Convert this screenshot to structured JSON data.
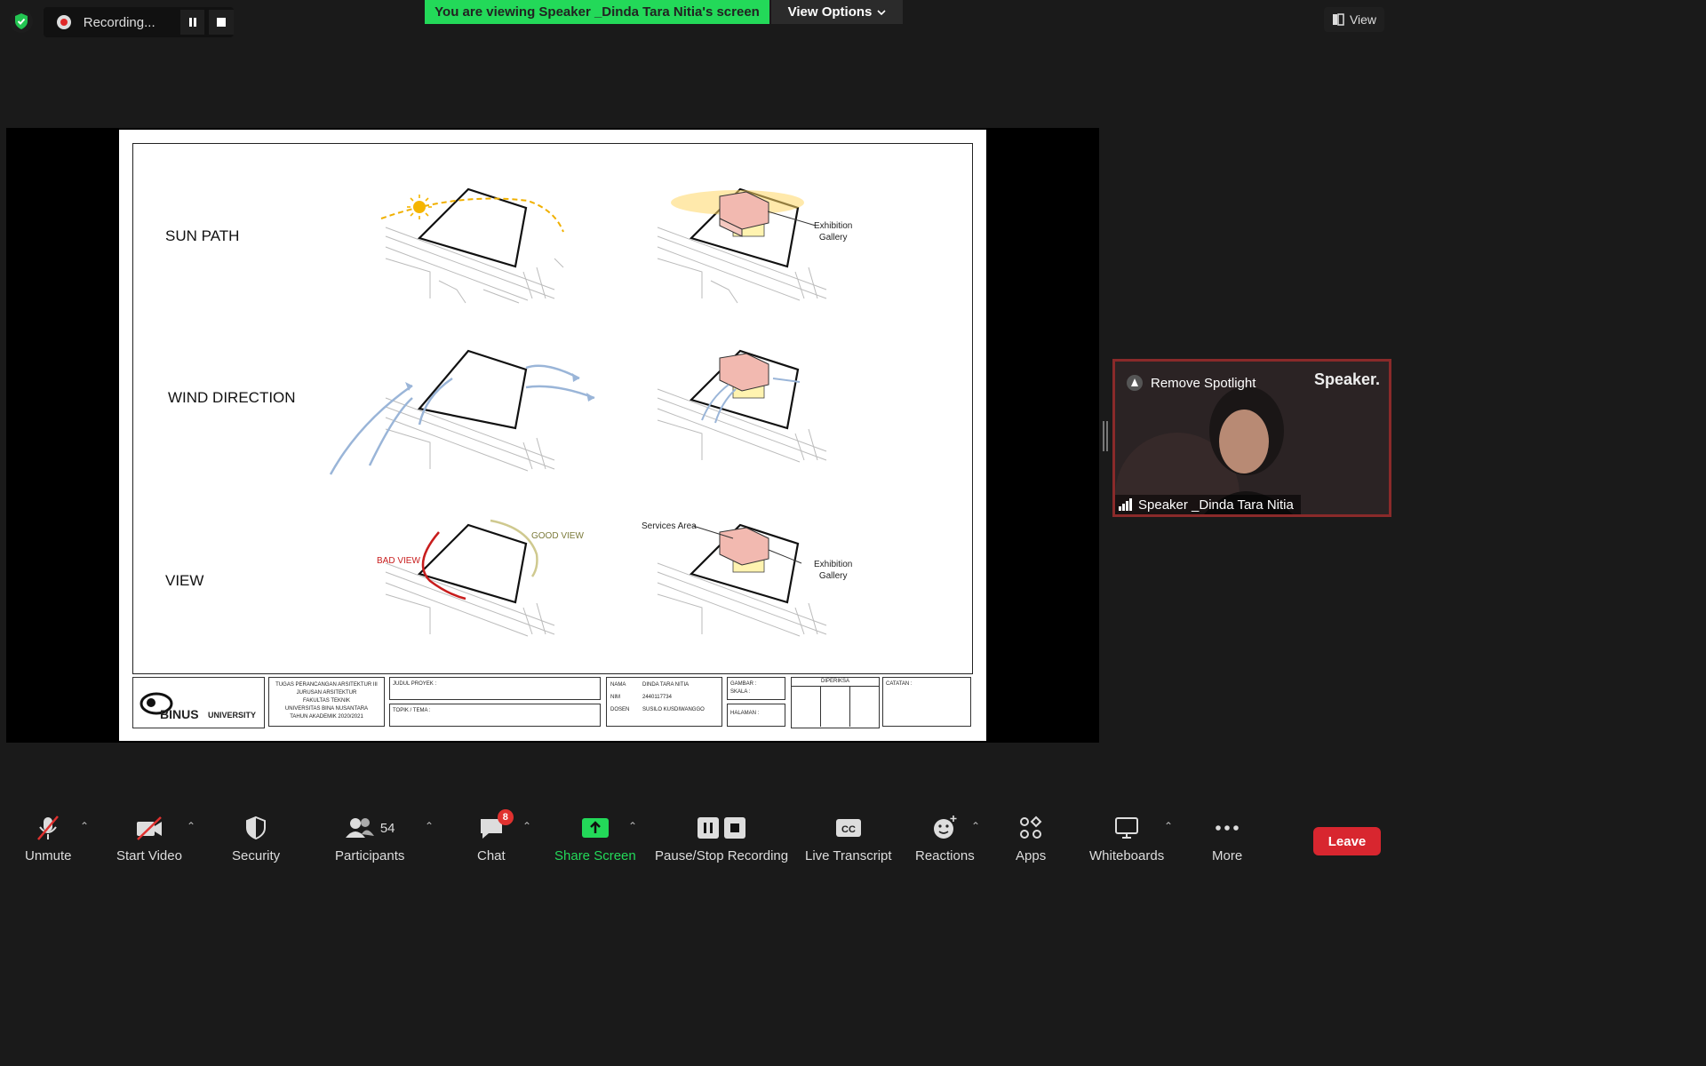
{
  "top": {
    "recording_label": "Recording...",
    "viewing_banner": "You are viewing Speaker _Dinda Tara Nitia's screen",
    "view_options": "View Options",
    "view_label": "View"
  },
  "slide": {
    "rows": [
      "SUN PATH",
      "WIND DIRECTION",
      "VIEW"
    ],
    "notes": {
      "exhibition1_a": "Exhibition",
      "exhibition1_b": "Gallery",
      "exhibition2_a": "Exhibition",
      "exhibition2_b": "Gallery",
      "services": "Services Area",
      "bad_view": "BAD VIEW",
      "good_view": "GOOD VIEW"
    },
    "title_block": {
      "logo": "BINUS",
      "logo_suffix": "UNIVERSITY",
      "course": [
        "TUGAS PERANCANGAN ARSITEKTUR III",
        "JURUSAN ARSITEKTUR",
        "FAKULTAS TEKNIK",
        "UNIVERSITAS BINA NUSANTARA",
        "TAHUN AKADEMIK 2020/2021"
      ],
      "judul": "JUDUL PROYEK :",
      "topik": "TOPIK / TEMA :",
      "nama_label": "NAMA",
      "nama_value": "DINDA TARA NITIA",
      "nim_label": "NIM",
      "nim_value": "2440117734",
      "dosen_label": "DOSEN",
      "dosen_value": "SUSILO KUSDIWANGGO",
      "gambar": "GAMBAR :",
      "skala": "SKALA :",
      "halaman": "HALAMAN :",
      "diperiksa": "DIPERIKSA",
      "catatan": "CATATAN :"
    }
  },
  "spotlight": {
    "remove": "Remove Spotlight",
    "speaker": "Speaker.",
    "name": "Speaker _Dinda Tara Nitia"
  },
  "toolbar": {
    "unmute": "Unmute",
    "start_video": "Start Video",
    "security": "Security",
    "participants": "Participants",
    "participant_count": "54",
    "chat": "Chat",
    "chat_badge": "8",
    "share_screen": "Share Screen",
    "pause_stop": "Pause/Stop Recording",
    "live_transcript": "Live Transcript",
    "reactions": "Reactions",
    "apps": "Apps",
    "whiteboards": "Whiteboards",
    "more": "More",
    "leave": "Leave"
  },
  "colors": {
    "banner": "#23d959",
    "share_green": "#23d959",
    "leave": "#d8262f",
    "tile_border": "#8a2a2a"
  }
}
